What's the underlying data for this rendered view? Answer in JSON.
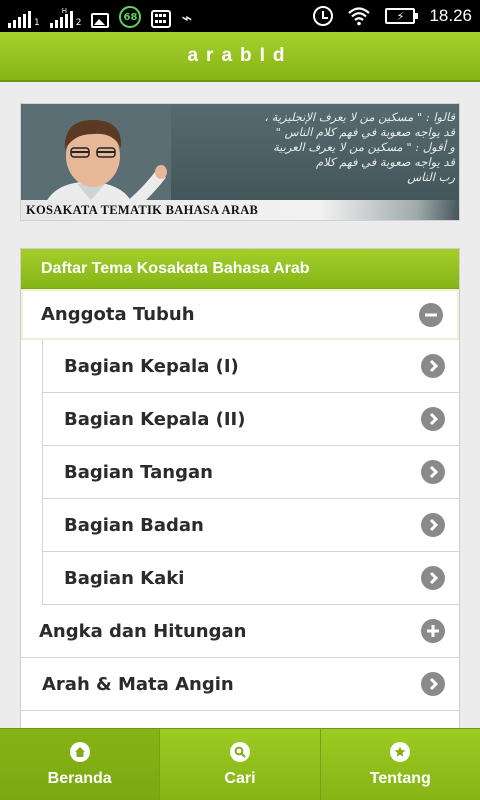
{
  "status_bar": {
    "sim1_label": "1",
    "sim1_type": "H",
    "sim2_label": "2",
    "notification_badge": "68",
    "time": "18.26",
    "icons": [
      "signal-icon",
      "image-notification-icon",
      "bbm-icon",
      "usb-icon",
      "alarm-icon",
      "wifi-icon",
      "battery-charging-icon"
    ]
  },
  "header": {
    "title": "arabId"
  },
  "banner": {
    "caption": "KOSAKATA TEMATIK BAHASA ARAB",
    "arabic_lines": [
      "قالوا : \" مسكين من لا يعرف الإنجليزية ،",
      "قد يواجه صعوبة في فهم كلام الناس \"",
      "و أقول : \" مسكين من لا يعرف العربية",
      "قد يواجه صعوبة في فهم كلام",
      "رب الناس"
    ]
  },
  "list": {
    "title": "Daftar Tema Kosakata Bahasa Arab",
    "groups": [
      {
        "label": "Anggota Tubuh",
        "icon": "minus-circle-icon",
        "expanded": true,
        "items": [
          {
            "label": "Bagian Kepala (I)",
            "icon": "chevron-right-icon"
          },
          {
            "label": "Bagian Kepala (II)",
            "icon": "chevron-right-icon"
          },
          {
            "label": "Bagian Tangan",
            "icon": "chevron-right-icon"
          },
          {
            "label": "Bagian Badan",
            "icon": "chevron-right-icon"
          },
          {
            "label": "Bagian Kaki",
            "icon": "chevron-right-icon"
          }
        ]
      },
      {
        "label": "Angka dan Hitungan",
        "icon": "plus-circle-icon",
        "expanded": false
      },
      {
        "label": "Arah & Mata Angin",
        "icon": "chevron-right-icon"
      }
    ]
  },
  "tabs": [
    {
      "label": "Beranda",
      "icon": "home-icon",
      "active": true
    },
    {
      "label": "Cari",
      "icon": "search-icon",
      "active": false
    },
    {
      "label": "Tentang",
      "icon": "star-icon",
      "active": false
    }
  ],
  "colors": {
    "accent": "#8fbd1c",
    "accent_dark": "#6d9512",
    "icon_gray": "#8a8a8a",
    "text": "#2b2b2b"
  }
}
